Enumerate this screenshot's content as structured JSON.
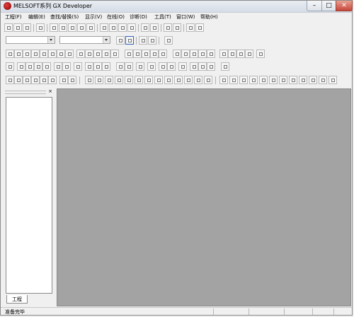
{
  "window": {
    "title": "MELSOFT系列 GX Developer",
    "min_glyph": "–",
    "max_glyph": "□",
    "close_glyph": "✕"
  },
  "menu": [
    {
      "id": "project",
      "label": "工程(F)"
    },
    {
      "id": "edit",
      "label": "编辑(E)"
    },
    {
      "id": "find-replace",
      "label": "查找/替换(S)"
    },
    {
      "id": "view",
      "label": "显示(V)"
    },
    {
      "id": "online",
      "label": "在线(O)"
    },
    {
      "id": "diagnostics",
      "label": "诊断(D)"
    },
    {
      "id": "tools",
      "label": "工具(T)"
    },
    {
      "id": "window",
      "label": "窗口(W)"
    },
    {
      "id": "help",
      "label": "帮助(H)"
    }
  ],
  "project_pane": {
    "close_glyph": "×",
    "tab_label": "工程"
  },
  "status": {
    "text": "准备完毕"
  }
}
